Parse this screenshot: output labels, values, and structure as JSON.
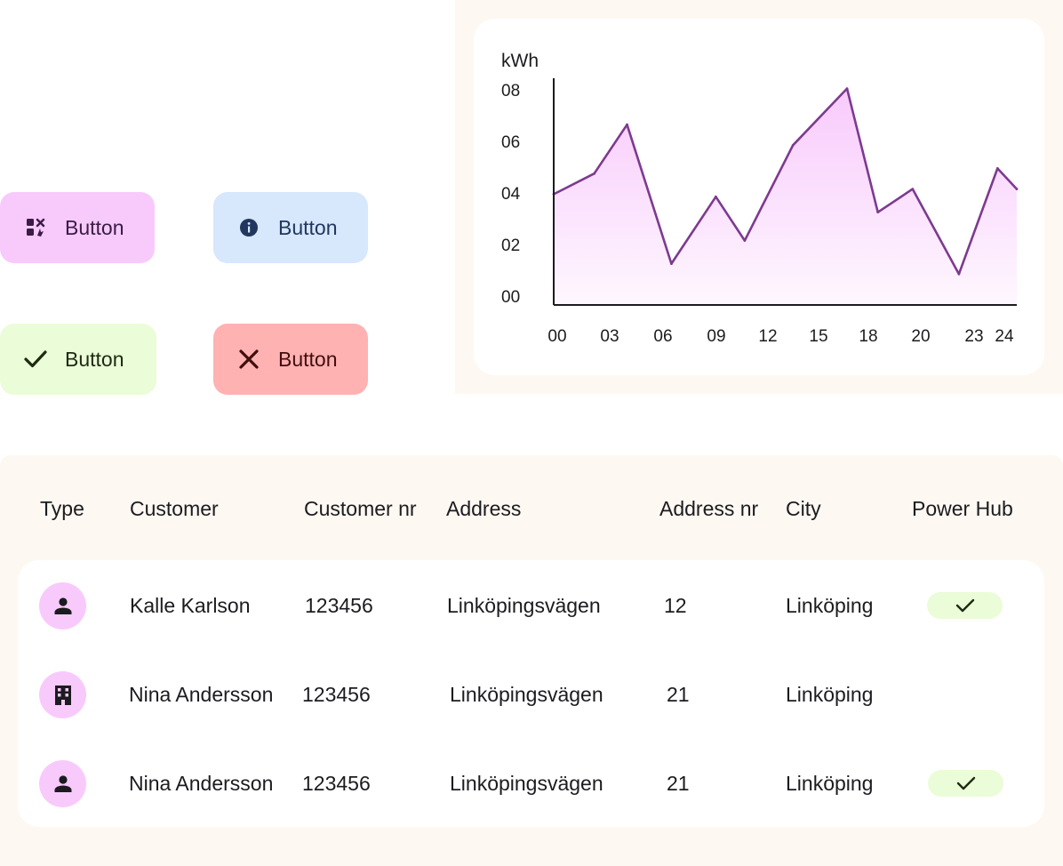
{
  "buttons": [
    {
      "label": "Button",
      "icon": "tools-icon",
      "color": "#f8cafc"
    },
    {
      "label": "Button",
      "icon": "info-icon",
      "color": "#d7e7fc"
    },
    {
      "label": "Button",
      "icon": "check-icon",
      "color": "#ebfcd8"
    },
    {
      "label": "Button",
      "icon": "close-icon",
      "color": "#ffb2b1"
    }
  ],
  "chart_data": {
    "type": "area",
    "ylabel": "kWh",
    "y_tick_labels": [
      "08",
      "06",
      "04",
      "02",
      "00"
    ],
    "x_tick_labels": [
      "00",
      "03",
      "06",
      "09",
      "12",
      "15",
      "18",
      "20",
      "23",
      "24"
    ],
    "ylim": [
      0,
      8.8
    ],
    "xlim": [
      0,
      24
    ],
    "x": [
      0,
      2.1,
      3.8,
      6.1,
      8.4,
      9.9,
      12.4,
      15.2,
      16.8,
      18.6,
      21.0,
      23.0,
      24.0
    ],
    "y": [
      4.3,
      5.1,
      7.0,
      1.6,
      4.2,
      2.5,
      6.2,
      8.4,
      3.6,
      4.5,
      1.2,
      5.3,
      4.5
    ],
    "line_color": "#7d3a8f",
    "fill_color": "#f8cafc",
    "grid": false
  },
  "table": {
    "headers": [
      "Type",
      "Customer",
      "Customer nr",
      "Address",
      "Address nr",
      "City",
      "Power Hub"
    ],
    "rows": [
      {
        "type_icon": "person-icon",
        "customer": "Kalle Karlson",
        "customer_nr": "123456",
        "address": "Linköpingsvägen",
        "address_nr": "12",
        "city": "Linköping",
        "power_hub": true
      },
      {
        "type_icon": "building-icon",
        "customer": "Nina Andersson",
        "customer_nr": "123456",
        "address": "Linköpingsvägen",
        "address_nr": "21",
        "city": "Linköping",
        "power_hub": false
      },
      {
        "type_icon": "person-icon",
        "customer": "Nina Andersson",
        "customer_nr": "123456",
        "address": "Linköpingsvägen",
        "address_nr": "21",
        "city": "Linköping",
        "power_hub": true
      }
    ]
  }
}
